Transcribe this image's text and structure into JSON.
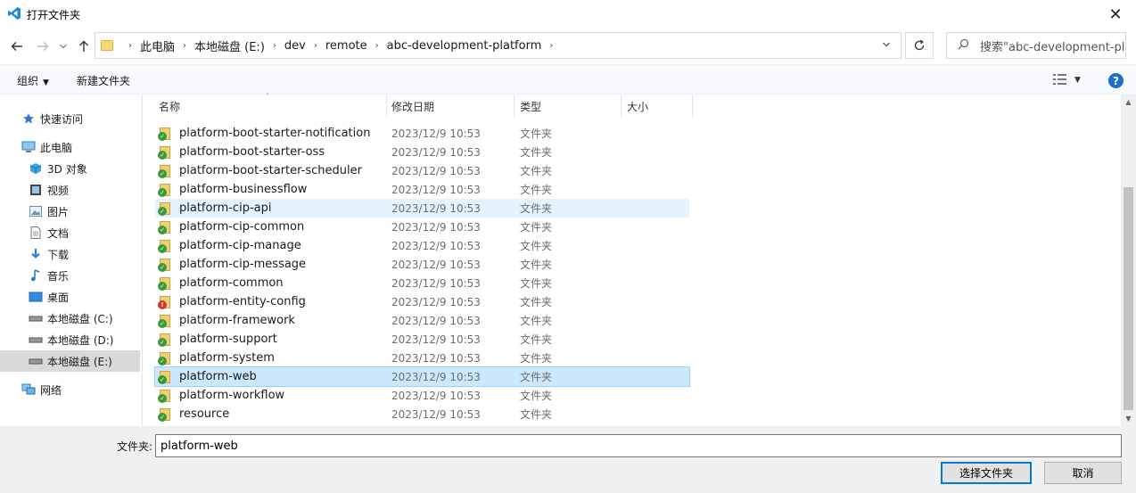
{
  "window": {
    "title": "打开文件夹",
    "close_glyph": "✕"
  },
  "address": {
    "crumbs": [
      "此电脑",
      "本地磁盘 (E:)",
      "dev",
      "remote",
      "abc-development-platform"
    ],
    "search_placeholder": "搜索\"abc-development-pl..."
  },
  "toolbar": {
    "organize": "组织",
    "new_folder": "新建文件夹"
  },
  "nav": [
    {
      "label": "快速访问",
      "icon": "star-icon"
    },
    {
      "label": "此电脑",
      "icon": "computer-icon"
    },
    {
      "label": "3D 对象",
      "icon": "cube-icon"
    },
    {
      "label": "视频",
      "icon": "video-icon"
    },
    {
      "label": "图片",
      "icon": "picture-icon"
    },
    {
      "label": "文档",
      "icon": "document-icon"
    },
    {
      "label": "下载",
      "icon": "download-icon"
    },
    {
      "label": "音乐",
      "icon": "music-icon"
    },
    {
      "label": "桌面",
      "icon": "desktop-icon"
    },
    {
      "label": "本地磁盘 (C:)",
      "icon": "drive-icon"
    },
    {
      "label": "本地磁盘 (D:)",
      "icon": "drive-icon"
    },
    {
      "label": "本地磁盘 (E:)",
      "icon": "drive-icon"
    },
    {
      "label": "网络",
      "icon": "network-icon"
    }
  ],
  "columns": {
    "name": "名称",
    "date": "修改日期",
    "type": "类型",
    "size": "大小"
  },
  "files": [
    {
      "name": "platform-boot-starter-notification",
      "date": "2023/12/9 10:53",
      "type": "文件夹",
      "status": "ok"
    },
    {
      "name": "platform-boot-starter-oss",
      "date": "2023/12/9 10:53",
      "type": "文件夹",
      "status": "ok"
    },
    {
      "name": "platform-boot-starter-scheduler",
      "date": "2023/12/9 10:53",
      "type": "文件夹",
      "status": "ok"
    },
    {
      "name": "platform-businessflow",
      "date": "2023/12/9 10:53",
      "type": "文件夹",
      "status": "ok"
    },
    {
      "name": "platform-cip-api",
      "date": "2023/12/9 10:53",
      "type": "文件夹",
      "status": "ok"
    },
    {
      "name": "platform-cip-common",
      "date": "2023/12/9 10:53",
      "type": "文件夹",
      "status": "ok"
    },
    {
      "name": "platform-cip-manage",
      "date": "2023/12/9 10:53",
      "type": "文件夹",
      "status": "ok"
    },
    {
      "name": "platform-cip-message",
      "date": "2023/12/9 10:53",
      "type": "文件夹",
      "status": "ok"
    },
    {
      "name": "platform-common",
      "date": "2023/12/9 10:53",
      "type": "文件夹",
      "status": "ok"
    },
    {
      "name": "platform-entity-config",
      "date": "2023/12/9 10:53",
      "type": "文件夹",
      "status": "error"
    },
    {
      "name": "platform-framework",
      "date": "2023/12/9 10:53",
      "type": "文件夹",
      "status": "ok"
    },
    {
      "name": "platform-support",
      "date": "2023/12/9 10:53",
      "type": "文件夹",
      "status": "ok"
    },
    {
      "name": "platform-system",
      "date": "2023/12/9 10:53",
      "type": "文件夹",
      "status": "ok"
    },
    {
      "name": "platform-web",
      "date": "2023/12/9 10:53",
      "type": "文件夹",
      "status": "ok"
    },
    {
      "name": "platform-workflow",
      "date": "2023/12/9 10:53",
      "type": "文件夹",
      "status": "ok"
    },
    {
      "name": "resource",
      "date": "2023/12/9 10:53",
      "type": "文件夹",
      "status": "ok"
    }
  ],
  "hover_row": "platform-cip-api",
  "selected_row": "platform-web",
  "selected_nav": "本地磁盘 (E:)",
  "footer": {
    "folder_label": "文件夹:",
    "folder_value": "platform-web",
    "select_button": "选择文件夹",
    "cancel_button": "取消"
  },
  "colors": {
    "accent": "#0078d7",
    "ok_badge": "#3a9a3a",
    "error_badge": "#d9342b",
    "folder": "#f3d06e"
  }
}
